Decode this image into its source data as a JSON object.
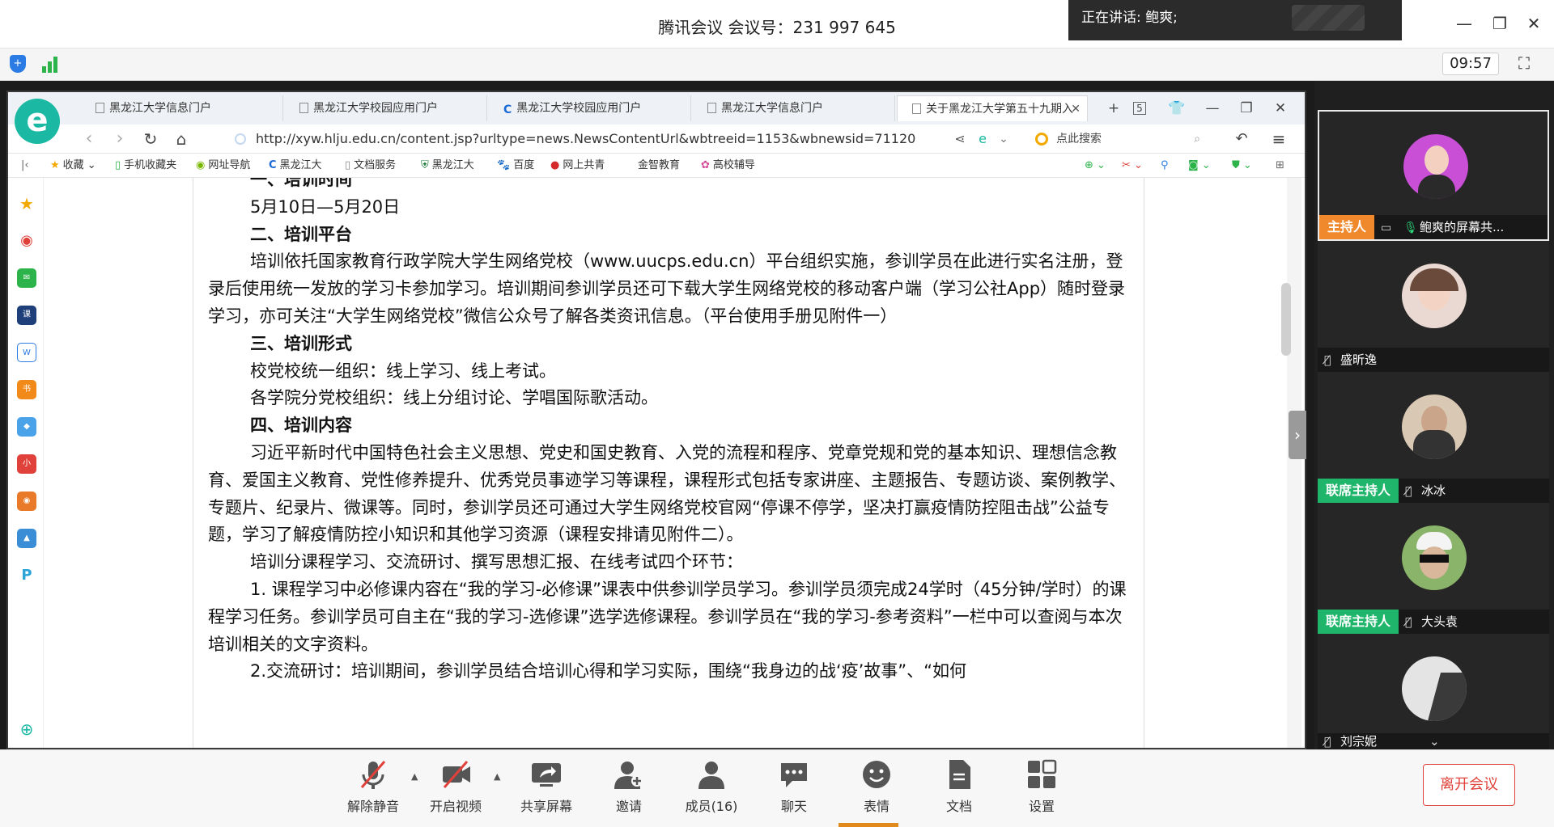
{
  "meeting": {
    "title": "腾讯会议 会议号：231 997 645",
    "speaking": "正在讲话: 鲍爽;",
    "time": "09:57"
  },
  "browser": {
    "tabs": [
      {
        "label": "黑龙江大学信息门户",
        "icon": "page"
      },
      {
        "label": "黑龙江大学校园应用门户",
        "icon": "page"
      },
      {
        "label": "黑龙江大学校园应用门户",
        "icon": "c-logo"
      },
      {
        "label": "黑龙江大学信息门户",
        "icon": "page"
      },
      {
        "label": "关于黑龙江大学第五十九期入",
        "icon": "page"
      }
    ],
    "tab_count": "5",
    "url": "http://xyw.hlju.edu.cn/content.jsp?urltype=news.NewsContentUrl&wbtreeid=1153&wbnewsid=71120",
    "search_placeholder": "点此搜索",
    "bookmarks": [
      "收藏",
      "手机收藏夹",
      "网址导航",
      "黑龙江大",
      "文档服务",
      "黑龙江大",
      "百度",
      "网上共青",
      "金智教育",
      "高校辅导"
    ]
  },
  "article": {
    "l1": "一、培训时间",
    "l2": "5月10日—5月20日",
    "l3": "二、培训平台",
    "l4": "培训依托国家教育行政学院大学生网络党校（www.uucps.edu.cn）平台组织实施，参训学员在此进行实名注册，登录后使用统一发放的学习卡参加学习。培训期间参训学员还可下载大学生网络党校的移动客户端（学习公社App）随时登录学习，亦可关注“大学生网络党校”微信公众号了解各类资讯信息。（平台使用手册见附件一）",
    "l5": "三、培训形式",
    "l6": "校党校统一组织：线上学习、线上考试。",
    "l7": "各学院分党校组织：线上分组讨论、学唱国际歌活动。",
    "l8": "四、培训内容",
    "l9": "习近平新时代中国特色社会主义思想、党史和国史教育、入党的流程和程序、党章党规和党的基本知识、理想信念教育、爱国主义教育、党性修养提升、优秀党员事迹学习等课程，课程形式包括专家讲座、主题报告、专题访谈、案例教学、专题片、纪录片、微课等。同时，参训学员还可通过大学生网络党校官网“停课不停学，坚决打赢疫情防控阻击战”公益专题，学习了解疫情防控小知识和其他学习资源（课程安排请见附件二）。",
    "l10": "培训分课程学习、交流研讨、撰写思想汇报、在线考试四个环节：",
    "l11": "1. 课程学习中必修课内容在“我的学习-必修课”课表中供参训学员学习。参训学员须完成24学时（45分钟/学时）的课程学习任务。参训学员可自主在“我的学习-选修课”选学选修课程。参训学员在“我的学习-参考资料”一栏中可以查阅与本次培训相关的文字资料。",
    "l12": "2.交流研讨：培训期间，参训学员结合培训心得和学习实际，围绕“我身边的战‘疫’故事”、“如何"
  },
  "participants": [
    {
      "role": "主持人",
      "name": "鲍爽的屏幕共...",
      "mic": "on"
    },
    {
      "role": "",
      "name": "盛昕逸",
      "mic": "muted"
    },
    {
      "role": "联席主持人",
      "name": "冰冰",
      "mic": "muted"
    },
    {
      "role": "联席主持人",
      "name": "大头袁",
      "mic": "muted"
    },
    {
      "role": "",
      "name": "刘宗妮",
      "mic": "muted"
    }
  ],
  "toolbar": {
    "mute": "解除静音",
    "video": "开启视频",
    "share": "共享屏幕",
    "invite": "邀请",
    "members": "成员(16)",
    "chat": "聊天",
    "emoji": "表情",
    "docs": "文档",
    "settings": "设置",
    "leave": "离开会议"
  },
  "colors": {
    "host": "#f0892b",
    "cohost": "#1fb66b",
    "leave": "#e0413a",
    "browser_logo": "#1bb8a4"
  }
}
